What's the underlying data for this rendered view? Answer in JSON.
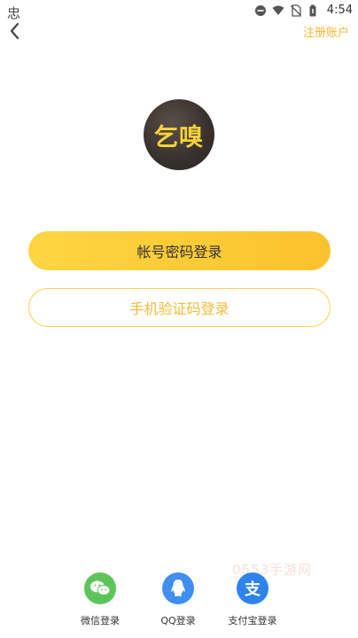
{
  "status_bar": {
    "left_text": "忠",
    "time": "4:54"
  },
  "nav": {
    "register_label": "注册账户"
  },
  "logo": {
    "text": "乞嗅"
  },
  "buttons": {
    "password_login": "帐号密码登录",
    "sms_login": "手机验证码登录"
  },
  "social": {
    "wechat_label": "微信登录",
    "qq_label": "QQ登录",
    "alipay_label": "支付宝登录",
    "alipay_glyph": "支"
  },
  "watermark": {
    "text": "0553手游网"
  },
  "colors": {
    "accent": "#fcc22d",
    "accent_text": "#f6b936",
    "wechat": "#5cc55a",
    "qq": "#3f8ef0",
    "alipay": "#2e84ec"
  }
}
